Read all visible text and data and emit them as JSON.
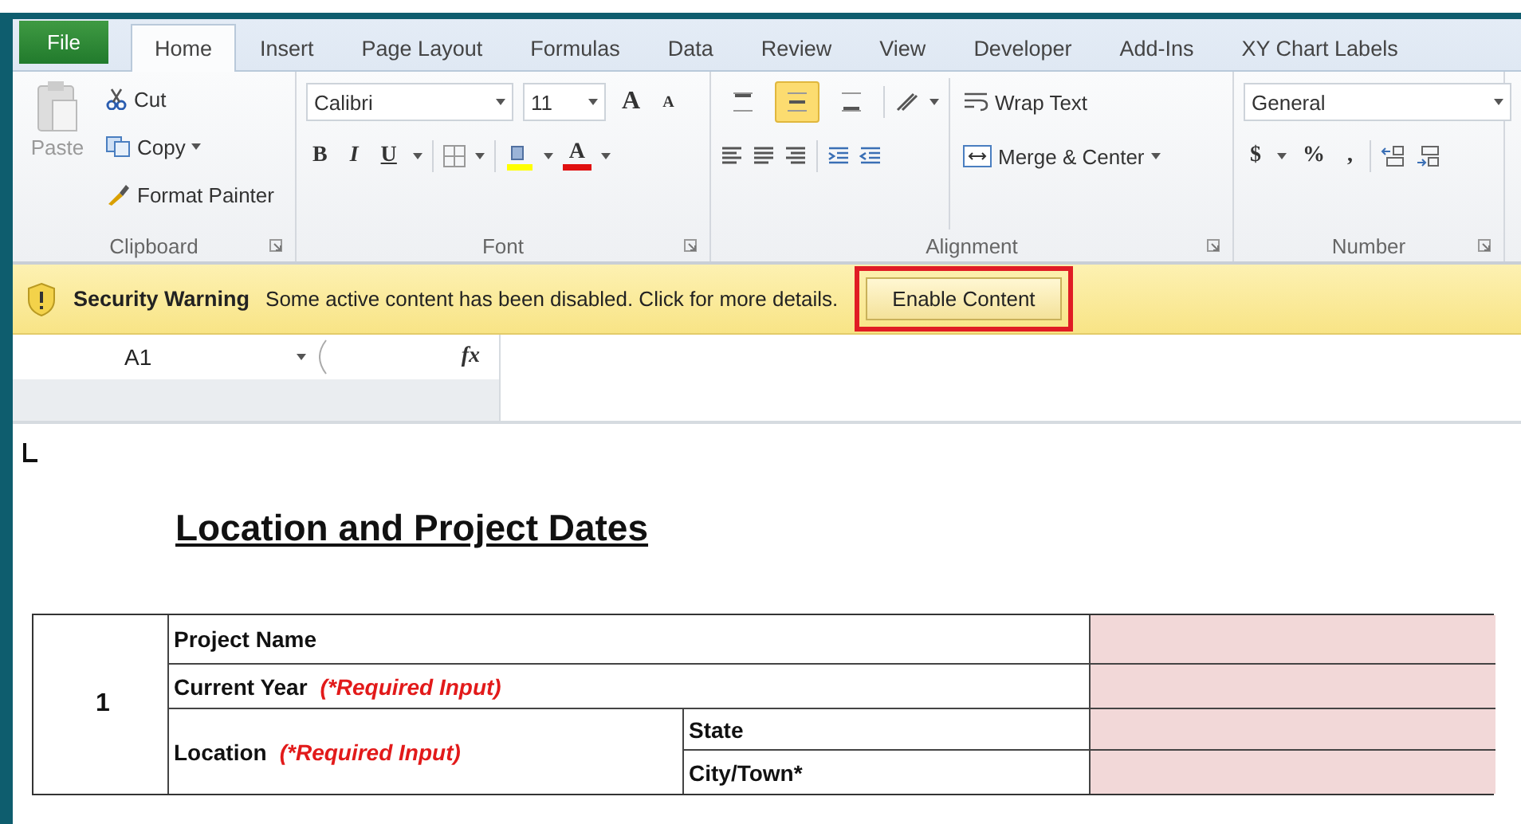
{
  "window": {
    "file_tab": "File",
    "tabs": [
      {
        "label": "Home",
        "selected": true
      },
      {
        "label": "Insert",
        "selected": false
      },
      {
        "label": "Page Layout",
        "selected": false
      },
      {
        "label": "Formulas",
        "selected": false
      },
      {
        "label": "Data",
        "selected": false
      },
      {
        "label": "Review",
        "selected": false
      },
      {
        "label": "View",
        "selected": false
      },
      {
        "label": "Developer",
        "selected": false
      },
      {
        "label": "Add-Ins",
        "selected": false
      },
      {
        "label": "XY Chart Labels",
        "selected": false
      }
    ]
  },
  "ribbon": {
    "clipboard": {
      "label": "Clipboard",
      "paste": "Paste",
      "cut": "Cut",
      "copy": "Copy",
      "format_painter": "Format Painter"
    },
    "font": {
      "label": "Font",
      "name": "Calibri",
      "size": "11",
      "grow": "A",
      "shrink": "A",
      "bold": "B",
      "italic": "I",
      "underline": "U",
      "font_color": "A"
    },
    "alignment": {
      "label": "Alignment",
      "wrap_text": "Wrap Text",
      "merge_center": "Merge & Center",
      "vertical_align": [
        {
          "selected": false
        },
        {
          "selected": true
        },
        {
          "selected": false
        }
      ]
    },
    "number": {
      "label": "Number",
      "format": "General",
      "currency": "$",
      "percent": "%",
      "comma": ","
    }
  },
  "security_bar": {
    "title": "Security Warning",
    "message": "Some active content has been disabled. Click for more details.",
    "button": {
      "label": "Enable Content",
      "highlighted": true
    }
  },
  "formula_bar": {
    "name_box": "A1",
    "fx": "fx"
  },
  "sheet": {
    "title": "Location and Project Dates",
    "table": {
      "number": "1",
      "rows": [
        {
          "label": "Project Name",
          "note": ""
        },
        {
          "label": "Current Year",
          "note": "(*Required Input)"
        },
        {
          "label": "Location",
          "note": "(*Required Input)",
          "sub": [
            "State",
            "City/Town*"
          ]
        }
      ]
    }
  }
}
